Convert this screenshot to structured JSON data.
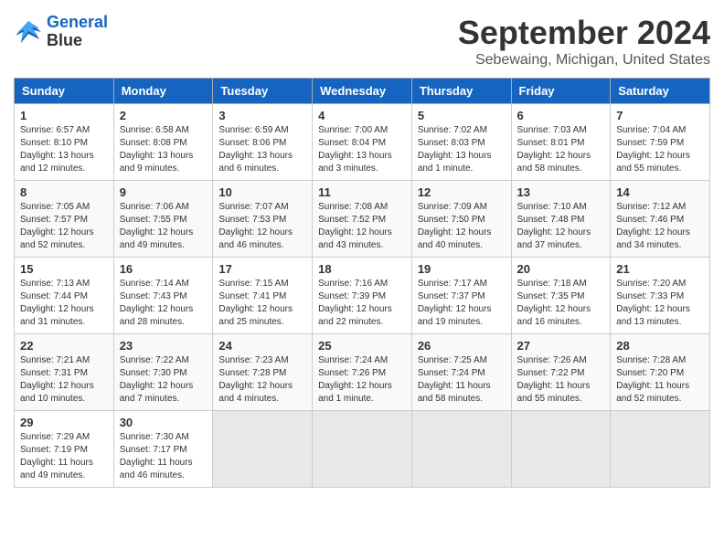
{
  "header": {
    "logo_line1": "General",
    "logo_line2": "Blue",
    "month": "September 2024",
    "location": "Sebewaing, Michigan, United States"
  },
  "weekdays": [
    "Sunday",
    "Monday",
    "Tuesday",
    "Wednesday",
    "Thursday",
    "Friday",
    "Saturday"
  ],
  "weeks": [
    [
      {
        "day": "1",
        "info": "Sunrise: 6:57 AM\nSunset: 8:10 PM\nDaylight: 13 hours\nand 12 minutes."
      },
      {
        "day": "2",
        "info": "Sunrise: 6:58 AM\nSunset: 8:08 PM\nDaylight: 13 hours\nand 9 minutes."
      },
      {
        "day": "3",
        "info": "Sunrise: 6:59 AM\nSunset: 8:06 PM\nDaylight: 13 hours\nand 6 minutes."
      },
      {
        "day": "4",
        "info": "Sunrise: 7:00 AM\nSunset: 8:04 PM\nDaylight: 13 hours\nand 3 minutes."
      },
      {
        "day": "5",
        "info": "Sunrise: 7:02 AM\nSunset: 8:03 PM\nDaylight: 13 hours\nand 1 minute."
      },
      {
        "day": "6",
        "info": "Sunrise: 7:03 AM\nSunset: 8:01 PM\nDaylight: 12 hours\nand 58 minutes."
      },
      {
        "day": "7",
        "info": "Sunrise: 7:04 AM\nSunset: 7:59 PM\nDaylight: 12 hours\nand 55 minutes."
      }
    ],
    [
      {
        "day": "8",
        "info": "Sunrise: 7:05 AM\nSunset: 7:57 PM\nDaylight: 12 hours\nand 52 minutes."
      },
      {
        "day": "9",
        "info": "Sunrise: 7:06 AM\nSunset: 7:55 PM\nDaylight: 12 hours\nand 49 minutes."
      },
      {
        "day": "10",
        "info": "Sunrise: 7:07 AM\nSunset: 7:53 PM\nDaylight: 12 hours\nand 46 minutes."
      },
      {
        "day": "11",
        "info": "Sunrise: 7:08 AM\nSunset: 7:52 PM\nDaylight: 12 hours\nand 43 minutes."
      },
      {
        "day": "12",
        "info": "Sunrise: 7:09 AM\nSunset: 7:50 PM\nDaylight: 12 hours\nand 40 minutes."
      },
      {
        "day": "13",
        "info": "Sunrise: 7:10 AM\nSunset: 7:48 PM\nDaylight: 12 hours\nand 37 minutes."
      },
      {
        "day": "14",
        "info": "Sunrise: 7:12 AM\nSunset: 7:46 PM\nDaylight: 12 hours\nand 34 minutes."
      }
    ],
    [
      {
        "day": "15",
        "info": "Sunrise: 7:13 AM\nSunset: 7:44 PM\nDaylight: 12 hours\nand 31 minutes."
      },
      {
        "day": "16",
        "info": "Sunrise: 7:14 AM\nSunset: 7:43 PM\nDaylight: 12 hours\nand 28 minutes."
      },
      {
        "day": "17",
        "info": "Sunrise: 7:15 AM\nSunset: 7:41 PM\nDaylight: 12 hours\nand 25 minutes."
      },
      {
        "day": "18",
        "info": "Sunrise: 7:16 AM\nSunset: 7:39 PM\nDaylight: 12 hours\nand 22 minutes."
      },
      {
        "day": "19",
        "info": "Sunrise: 7:17 AM\nSunset: 7:37 PM\nDaylight: 12 hours\nand 19 minutes."
      },
      {
        "day": "20",
        "info": "Sunrise: 7:18 AM\nSunset: 7:35 PM\nDaylight: 12 hours\nand 16 minutes."
      },
      {
        "day": "21",
        "info": "Sunrise: 7:20 AM\nSunset: 7:33 PM\nDaylight: 12 hours\nand 13 minutes."
      }
    ],
    [
      {
        "day": "22",
        "info": "Sunrise: 7:21 AM\nSunset: 7:31 PM\nDaylight: 12 hours\nand 10 minutes."
      },
      {
        "day": "23",
        "info": "Sunrise: 7:22 AM\nSunset: 7:30 PM\nDaylight: 12 hours\nand 7 minutes."
      },
      {
        "day": "24",
        "info": "Sunrise: 7:23 AM\nSunset: 7:28 PM\nDaylight: 12 hours\nand 4 minutes."
      },
      {
        "day": "25",
        "info": "Sunrise: 7:24 AM\nSunset: 7:26 PM\nDaylight: 12 hours\nand 1 minute."
      },
      {
        "day": "26",
        "info": "Sunrise: 7:25 AM\nSunset: 7:24 PM\nDaylight: 11 hours\nand 58 minutes."
      },
      {
        "day": "27",
        "info": "Sunrise: 7:26 AM\nSunset: 7:22 PM\nDaylight: 11 hours\nand 55 minutes."
      },
      {
        "day": "28",
        "info": "Sunrise: 7:28 AM\nSunset: 7:20 PM\nDaylight: 11 hours\nand 52 minutes."
      }
    ],
    [
      {
        "day": "29",
        "info": "Sunrise: 7:29 AM\nSunset: 7:19 PM\nDaylight: 11 hours\nand 49 minutes."
      },
      {
        "day": "30",
        "info": "Sunrise: 7:30 AM\nSunset: 7:17 PM\nDaylight: 11 hours\nand 46 minutes."
      },
      {
        "day": "",
        "info": ""
      },
      {
        "day": "",
        "info": ""
      },
      {
        "day": "",
        "info": ""
      },
      {
        "day": "",
        "info": ""
      },
      {
        "day": "",
        "info": ""
      }
    ]
  ]
}
